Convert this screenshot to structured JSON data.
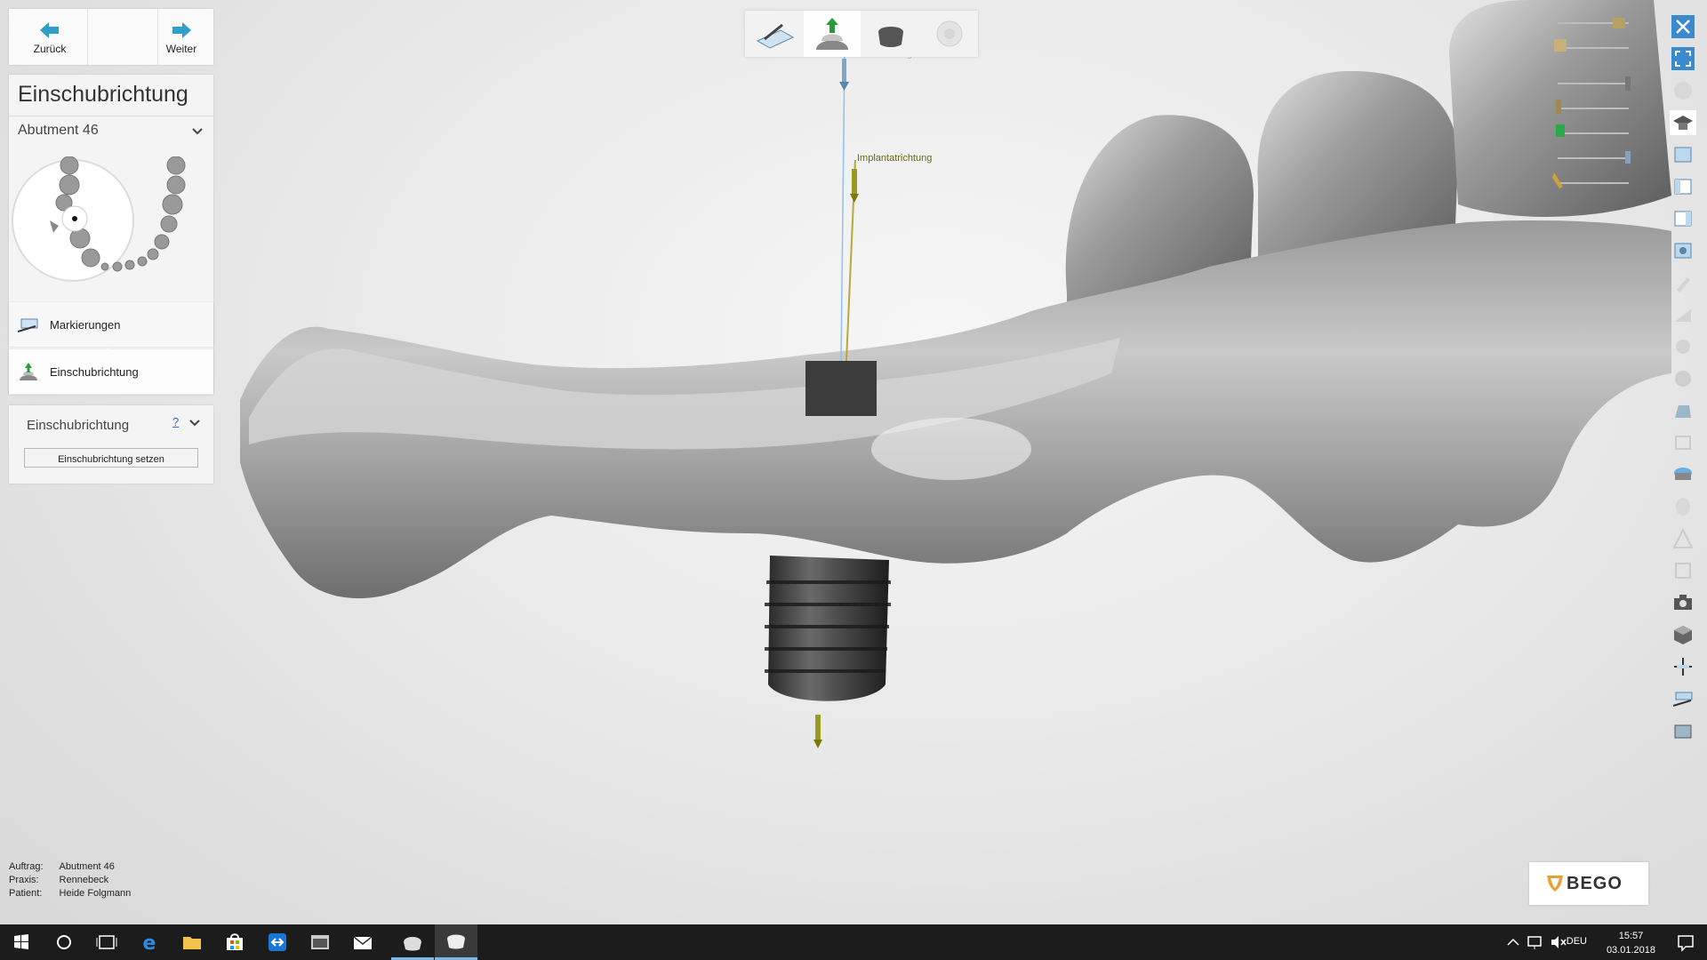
{
  "nav": {
    "back_label": "Zurück",
    "next_label": "Weiter"
  },
  "panel": {
    "title": "Einschubrichtung",
    "selected_abutment": "Abutment 46"
  },
  "steps": [
    {
      "label": "Markierungen"
    },
    {
      "label": "Einschubrichtung"
    }
  ],
  "subpanel": {
    "title": "Einschubrichtung",
    "help": "?",
    "button_label": "Einschubrichtung setzen"
  },
  "info": {
    "auftrag_label": "Auftrag:",
    "auftrag_value": "Abutment 46",
    "praxis_label": "Praxis:",
    "praxis_value": "Rennebeck",
    "patient_label": "Patient:",
    "patient_value": "Heide Folgmann"
  },
  "scene": {
    "tooltip": "Einschubrichtung",
    "implant_label": "Implantatrichtung"
  },
  "brand": {
    "logo_text": "BEGO"
  },
  "taskbar": {
    "lang": "DEU",
    "time": "15:57",
    "date": "03.01.2018"
  },
  "colors": {
    "accent": "#2f9fc9",
    "panel": "#f4f4f4",
    "taskbar": "#1c1c1c",
    "implant_axis": "#9a9a20"
  }
}
